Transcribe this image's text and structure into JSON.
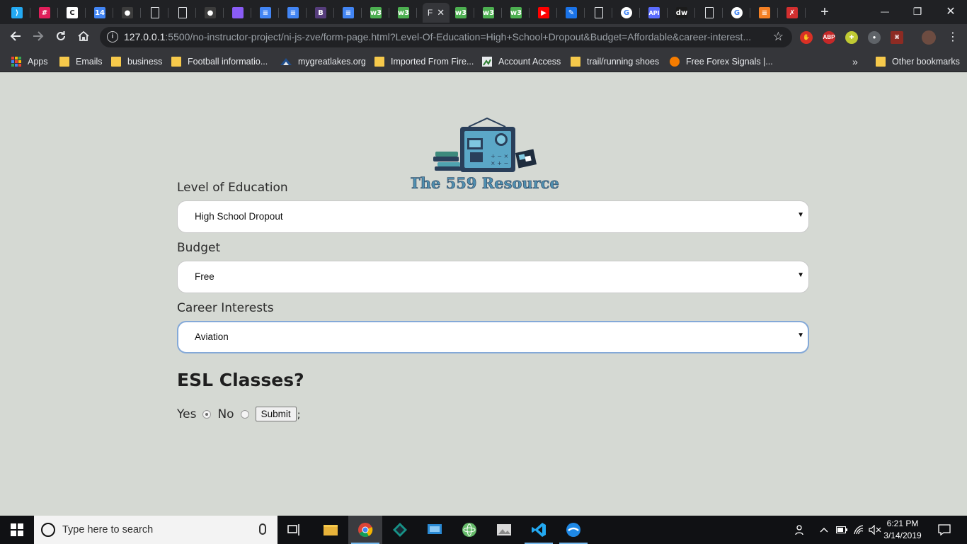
{
  "browser": {
    "tabs": [
      {
        "icon": "vscode-icon",
        "color": "#23a9f2",
        "glyph": "⟩"
      },
      {
        "icon": "slack-icon",
        "color": "#e01e5a",
        "glyph": "#"
      },
      {
        "icon": "page-icon",
        "color": "#ffffff",
        "glyph": "C"
      },
      {
        "icon": "calendar-icon",
        "color": "#4285f4",
        "glyph": "14"
      },
      {
        "icon": "github-icon",
        "color": "#3c3c3c",
        "glyph": "●"
      },
      {
        "icon": "document-icon",
        "color": "#ffffff",
        "glyph": ""
      },
      {
        "icon": "document-icon",
        "color": "#ffffff",
        "glyph": ""
      },
      {
        "icon": "github-icon",
        "color": "#3c3c3c",
        "glyph": "●"
      },
      {
        "icon": "gradient-icon",
        "color": "#8a5cf6",
        "glyph": ""
      },
      {
        "icon": "google-docs-icon",
        "color": "#4285f4",
        "glyph": "≡"
      },
      {
        "icon": "google-docs-icon",
        "color": "#4285f4",
        "glyph": "≡"
      },
      {
        "icon": "bootstrap-icon",
        "color": "#563d7c",
        "glyph": "B"
      },
      {
        "icon": "google-docs-icon",
        "color": "#4285f4",
        "glyph": "≡"
      },
      {
        "icon": "w3schools-icon",
        "color": "#4caf50",
        "glyph": "w3"
      },
      {
        "icon": "w3schools-icon",
        "color": "#4caf50",
        "glyph": "w3"
      }
    ],
    "active_tab": {
      "title": "F",
      "close": "✕"
    },
    "tabs_after": [
      {
        "icon": "w3schools-icon",
        "color": "#4caf50",
        "glyph": "w3"
      },
      {
        "icon": "w3schools-icon",
        "color": "#4caf50",
        "glyph": "w3"
      },
      {
        "icon": "w3schools-icon",
        "color": "#4caf50",
        "glyph": "w3"
      },
      {
        "icon": "youtube-icon",
        "color": "#ff0000",
        "glyph": "▶"
      },
      {
        "icon": "app-icon",
        "color": "#1a73e8",
        "glyph": "✎"
      },
      {
        "icon": "document-icon",
        "color": "#ffffff",
        "glyph": ""
      },
      {
        "icon": "google-icon",
        "color": "#ffffff",
        "glyph": "G"
      },
      {
        "icon": "api-icon",
        "color": "#5b6cff",
        "glyph": "API"
      },
      {
        "icon": "dw-icon",
        "color": "#1b1b1b",
        "glyph": "dw"
      },
      {
        "icon": "document-icon",
        "color": "#ffffff",
        "glyph": ""
      },
      {
        "icon": "google-icon",
        "color": "#ffffff",
        "glyph": "G"
      },
      {
        "icon": "stackoverflow-icon",
        "color": "#f48024",
        "glyph": "≡"
      },
      {
        "icon": "figure-icon",
        "color": "#d32f2f",
        "glyph": "✗"
      }
    ],
    "new_tab": "+",
    "window": {
      "minimize": "—",
      "restore": "❐",
      "close": "✕"
    },
    "url_host": "127.0.0.1",
    "url_rest": ":5500/no-instructor-project/ni-js-zve/form-page.html?Level-Of-Education=High+School+Dropout&Budget=Affordable&career-interest...",
    "bookmarks": [
      {
        "label": "Apps",
        "icon": "apps-icon"
      },
      {
        "label": "Emails",
        "icon": "folder-icon"
      },
      {
        "label": "business",
        "icon": "folder-icon"
      },
      {
        "label": "Football informatio...",
        "icon": "folder-icon"
      },
      {
        "label": "mygreatlakes.org",
        "icon": "mountain-icon"
      },
      {
        "label": "Imported From Fire...",
        "icon": "folder-icon"
      },
      {
        "label": "Account Access",
        "icon": "account-icon"
      },
      {
        "label": "trail/running shoes",
        "icon": "folder-icon"
      },
      {
        "label": "Free Forex Signals |...",
        "icon": "forex-icon"
      }
    ],
    "more_bookmarks": "»",
    "other_bookmarks": "Other bookmarks"
  },
  "page": {
    "logo_text": "The 559 Resource",
    "education": {
      "label": "Level of Education",
      "value": "High School Dropout"
    },
    "budget": {
      "label": "Budget",
      "value": "Free"
    },
    "career": {
      "label": "Career Interests",
      "value": "Aviation"
    },
    "esl": {
      "heading": "ESL Classes?",
      "yes_label": "Yes",
      "no_label": "No",
      "selected": "Yes",
      "submit_label": "Submit",
      "trailing": ";"
    },
    "select_arrow": "▼"
  },
  "taskbar": {
    "search_placeholder": "Type here to search",
    "time": "6:21 PM",
    "date": "3/14/2019"
  }
}
